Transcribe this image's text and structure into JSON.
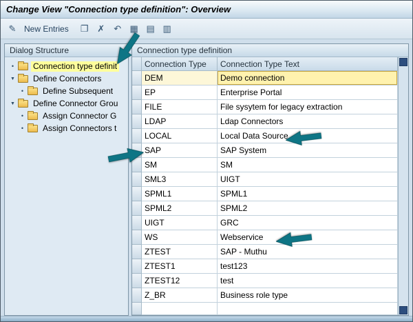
{
  "window": {
    "title": "Change View \"Connection type definition\": Overview"
  },
  "toolbar": {
    "change_display_icon_glyph": "✎",
    "new_entries_label": "New Entries",
    "icons": [
      {
        "name": "copy-as-icon",
        "glyph": "❐"
      },
      {
        "name": "delete-icon",
        "glyph": "✗"
      },
      {
        "name": "undo-icon",
        "glyph": "↶"
      },
      {
        "name": "select-all-icon",
        "glyph": "▦"
      },
      {
        "name": "select-block-icon",
        "glyph": "▤"
      },
      {
        "name": "deselect-all-icon",
        "glyph": "▥"
      }
    ]
  },
  "dialog_structure": {
    "title": "Dialog Structure",
    "items": [
      {
        "label": "Connection type definit",
        "level": 0,
        "expandable": false,
        "selected": true
      },
      {
        "label": "Define Connectors",
        "level": 0,
        "expandable": true,
        "selected": false
      },
      {
        "label": "Define Subsequent",
        "level": 1,
        "expandable": false,
        "selected": false
      },
      {
        "label": "Define Connector Grou",
        "level": 0,
        "expandable": true,
        "selected": false
      },
      {
        "label": "Assign Connector G",
        "level": 1,
        "expandable": false,
        "selected": false
      },
      {
        "label": "Assign Connectors t",
        "level": 1,
        "expandable": false,
        "selected": false
      }
    ]
  },
  "table": {
    "title": "Connection type definition",
    "columns": [
      "Connection Type",
      "Connection Type Text"
    ],
    "rows": [
      {
        "type": "DEM",
        "text": "Demo connection",
        "selected": true
      },
      {
        "type": "EP",
        "text": "Enterprise Portal",
        "selected": false
      },
      {
        "type": "FILE",
        "text": "File sysytem for legacy extraction",
        "selected": false
      },
      {
        "type": "LDAP",
        "text": "Ldap Connectors",
        "selected": false
      },
      {
        "type": "LOCAL",
        "text": "Local Data Source",
        "selected": false
      },
      {
        "type": "SAP",
        "text": "SAP System",
        "selected": false
      },
      {
        "type": "SM",
        "text": "SM",
        "selected": false
      },
      {
        "type": "SML3",
        "text": "UIGT",
        "selected": false
      },
      {
        "type": "SPML1",
        "text": "SPML1",
        "selected": false
      },
      {
        "type": "SPML2",
        "text": "SPML2",
        "selected": false
      },
      {
        "type": "UIGT",
        "text": "GRC",
        "selected": false
      },
      {
        "type": "WS",
        "text": "Webservice",
        "selected": false
      },
      {
        "type": "ZTEST",
        "text": "SAP - Muthu",
        "selected": false
      },
      {
        "type": "ZTEST1",
        "text": "test123",
        "selected": false
      },
      {
        "type": "ZTEST12",
        "text": "test",
        "selected": false
      },
      {
        "type": "Z_BR",
        "text": "Business role type",
        "selected": false
      }
    ]
  },
  "colors": {
    "arrow": "#0e7585",
    "selection_yellow": "#fff2ae",
    "tree_selection_yellow": "#ffff9c"
  }
}
